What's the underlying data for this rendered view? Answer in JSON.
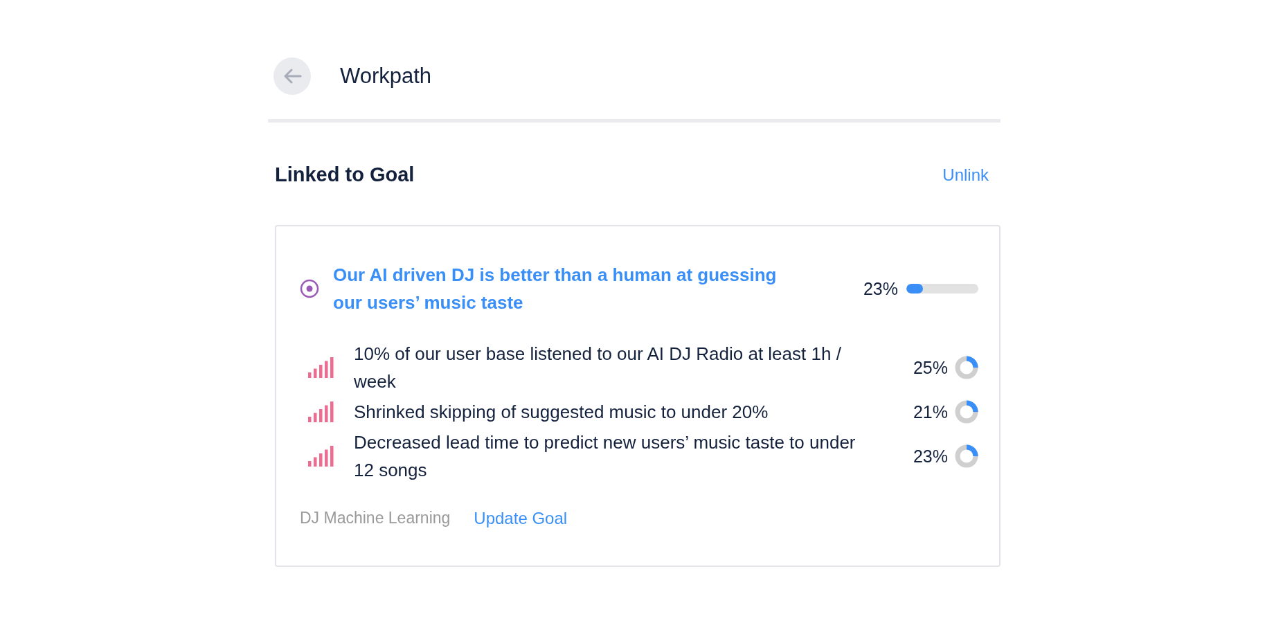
{
  "header": {
    "title": "Workpath"
  },
  "section": {
    "title": "Linked to Goal",
    "action": "Unlink"
  },
  "goal": {
    "title": "Our AI driven DJ is better than a human at guessing our users’ music taste",
    "percent": "23%",
    "level": 0.23,
    "key_results": [
      {
        "text": "10% of our user base listened to our AI DJ Radio at least 1h / week",
        "percent": "25%"
      },
      {
        "text": "Shrinked skipping of suggested music to under 20%",
        "percent": "21%"
      },
      {
        "text": "Decreased lead time to predict new users’ music taste to under 12 songs",
        "percent": "23%"
      }
    ],
    "team": "DJ Machine Learning",
    "update_link": "Update Goal"
  }
}
